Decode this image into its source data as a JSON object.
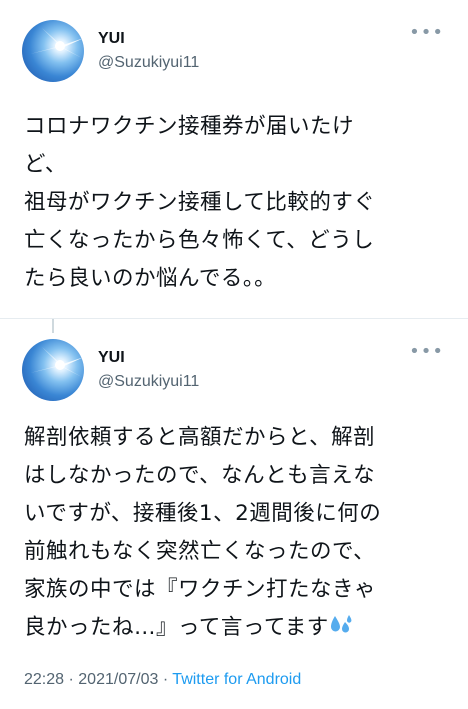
{
  "tweets": [
    {
      "display_name": "YUI",
      "handle": "@Suzukiyui11",
      "more_icon": "more-horizontal-icon",
      "text_lines": [
        "コロナワクチン接種券が届いたけ",
        "ど、",
        "祖母がワクチン接種して比較的すぐ",
        "亡くなったから色々怖くて、どうし",
        "たら良いのか悩んでる。。"
      ]
    },
    {
      "display_name": "YUI",
      "handle": "@Suzukiyui11",
      "more_icon": "more-horizontal-icon",
      "text_lines": [
        "解剖依頼すると高額だからと、解剖",
        "はしなかったので、なんとも言えな",
        "いですが、接種後1、2週間後に何の",
        "前触れもなく突然亡くなったので、",
        "家族の中では『ワクチン打たなきゃ",
        "良かったね…』って言ってます"
      ],
      "trailing_emoji": "sweat-droplets-emoji",
      "time": "22:28",
      "separator": "·",
      "date": "2021/07/03",
      "source": "Twitter for Android",
      "source_color": "#1d9bf0"
    }
  ]
}
